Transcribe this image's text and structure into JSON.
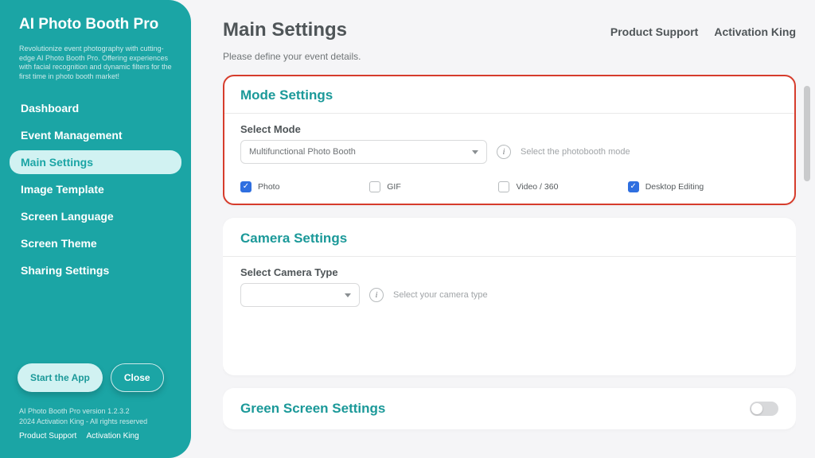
{
  "sidebar": {
    "brand": "AI Photo Booth Pro",
    "tagline": "Revolutionize event photography with cutting-edge AI Photo Booth Pro. Offering experiences with facial recognition and dynamic filters for the first time in photo booth market!",
    "nav": [
      {
        "label": "Dashboard"
      },
      {
        "label": "Event Management"
      },
      {
        "label": "Main Settings",
        "active": true
      },
      {
        "label": "Image Template"
      },
      {
        "label": "Screen Language"
      },
      {
        "label": "Screen Theme"
      },
      {
        "label": "Sharing Settings"
      }
    ],
    "buttons": {
      "start": "Start the App",
      "close": "Close"
    },
    "footer": {
      "version": "AI Photo Booth Pro version 1.2.3.2",
      "copyright": "2024 Activation King - All rights reserved",
      "link1": "Product Support",
      "link2": "Activation King"
    }
  },
  "header": {
    "title": "Main Settings",
    "link1": "Product Support",
    "link2": "Activation King",
    "subtitle": "Please define your event details."
  },
  "mode_section": {
    "title": "Mode Settings",
    "label": "Select Mode",
    "selected": "Multifunctional Photo Booth",
    "hint": "Select the photobooth mode",
    "options": [
      {
        "label": "Photo",
        "checked": true
      },
      {
        "label": "GIF",
        "checked": false
      },
      {
        "label": "Video / 360",
        "checked": false
      },
      {
        "label": "Desktop Editing",
        "checked": true
      }
    ]
  },
  "camera_section": {
    "title": "Camera Settings",
    "label": "Select Camera Type",
    "hint": "Select your camera type"
  },
  "green_section": {
    "title": "Green Screen Settings"
  }
}
